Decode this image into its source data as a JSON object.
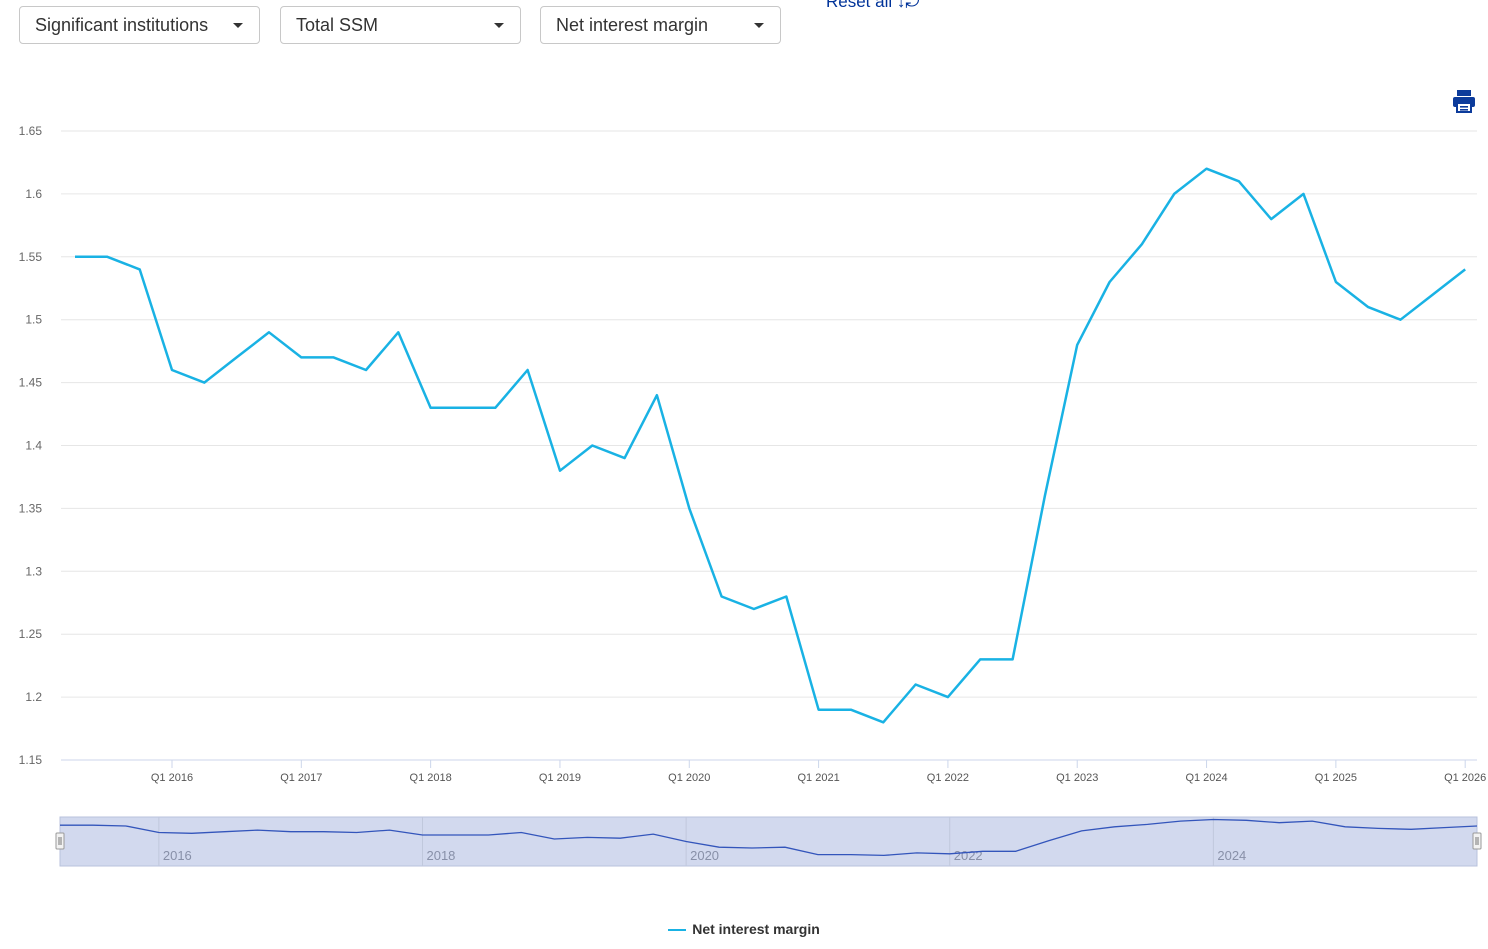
{
  "controls": {
    "dropdown_institutions": "Significant institutions",
    "dropdown_scope": "Total SSM",
    "dropdown_indicator": "Net interest margin",
    "reset_label": "Reset all ↓⤾"
  },
  "icons": {
    "print": "print-icon"
  },
  "colors": {
    "series": "#19b2e4",
    "navigator_series": "#3355bb",
    "navigator_fill": "#d2d9ee",
    "link": "#003399"
  },
  "chart_data": {
    "type": "line",
    "title": "",
    "xlabel": "",
    "ylabel": "",
    "ylim": [
      1.15,
      1.65
    ],
    "y_ticks": [
      "1.15",
      "1.2",
      "1.25",
      "1.3",
      "1.35",
      "1.4",
      "1.45",
      "1.5",
      "1.55",
      "1.6",
      "1.65"
    ],
    "x_ticks": [
      "Q1 2016",
      "Q1 2017",
      "Q1 2018",
      "Q1 2019",
      "Q1 2020",
      "Q1 2021",
      "Q1 2022",
      "Q1 2023",
      "Q1 2024",
      "Q1 2025",
      "Q1 2026"
    ],
    "navigator_ticks": [
      "2016",
      "2018",
      "2020",
      "2022",
      "2024"
    ],
    "grid": true,
    "legend": "bottom-center",
    "series": [
      {
        "name": "Net interest margin",
        "x": [
          "Q2 2015",
          "Q3 2015",
          "Q4 2015",
          "Q1 2016",
          "Q2 2016",
          "Q3 2016",
          "Q4 2016",
          "Q1 2017",
          "Q2 2017",
          "Q3 2017",
          "Q4 2017",
          "Q1 2018",
          "Q2 2018",
          "Q3 2018",
          "Q4 2018",
          "Q1 2019",
          "Q2 2019",
          "Q3 2019",
          "Q4 2019",
          "Q1 2020",
          "Q2 2020",
          "Q3 2020",
          "Q4 2020",
          "Q1 2021",
          "Q2 2021",
          "Q3 2021",
          "Q4 2021",
          "Q1 2022",
          "Q2 2022",
          "Q3 2022",
          "Q4 2022",
          "Q1 2023",
          "Q2 2023",
          "Q3 2023",
          "Q4 2023",
          "Q1 2024",
          "Q2 2024",
          "Q3 2024",
          "Q4 2024",
          "Q1 2025",
          "Q2 2025",
          "Q3 2025",
          "Q4 2025",
          "Q1 2026"
        ],
        "values": [
          1.55,
          1.55,
          1.54,
          1.46,
          1.45,
          1.47,
          1.49,
          1.47,
          1.47,
          1.46,
          1.49,
          1.43,
          1.43,
          1.43,
          1.46,
          1.38,
          1.4,
          1.39,
          1.44,
          1.35,
          1.28,
          1.27,
          1.28,
          1.19,
          1.19,
          1.18,
          1.21,
          1.2,
          1.23,
          1.23,
          1.36,
          1.48,
          1.53,
          1.56,
          1.6,
          1.62,
          1.61,
          1.58,
          1.6,
          1.53,
          1.51,
          1.5,
          1.52,
          1.54
        ]
      }
    ]
  }
}
